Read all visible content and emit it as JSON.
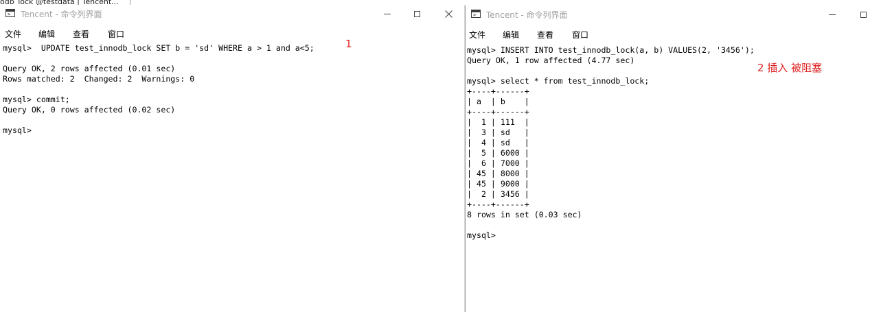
{
  "background_window": {
    "title_fragment": "odb_lock @testdata | Tencent..."
  },
  "window1": {
    "title": "Tencent - 命令列界面",
    "menu": [
      "文件",
      "编辑",
      "查看",
      "窗口"
    ],
    "console_lines": [
      "mysql>  UPDATE test_innodb_lock SET b = 'sd' WHERE a > 1 and a<5;",
      "",
      "Query OK, 2 rows affected (0.01 sec)",
      "Rows matched: 2  Changed: 2  Warnings: 0",
      "",
      "mysql> commit;",
      "Query OK, 0 rows affected (0.02 sec)",
      "",
      "mysql>"
    ],
    "annotation": "1"
  },
  "window2": {
    "title": "Tencent - 命令列界面",
    "menu": [
      "文件",
      "编辑",
      "查看",
      "窗口"
    ],
    "console_lines": [
      "mysql> INSERT INTO test_innodb_lock(a, b) VALUES(2, '3456');",
      "Query OK, 1 row affected (4.77 sec)",
      "",
      "mysql> select * from test_innodb_lock;",
      "+----+------+",
      "| a  | b    |",
      "+----+------+",
      "|  1 | 111  |",
      "|  3 | sd   |",
      "|  4 | sd   |",
      "|  5 | 6000 |",
      "|  6 | 7000 |",
      "| 45 | 8000 |",
      "| 45 | 9000 |",
      "|  2 | 3456 |",
      "+----+------+",
      "8 rows in set (0.03 sec)",
      "",
      "mysql>"
    ],
    "annotation": "2  插入 被阻塞"
  },
  "colors": {
    "annotation": "#e02020",
    "title_inactive": "#a0a0a0"
  },
  "icons": {
    "app": "terminal-icon",
    "minimize": "minimize-icon",
    "maximize": "maximize-icon",
    "close": "close-icon"
  }
}
